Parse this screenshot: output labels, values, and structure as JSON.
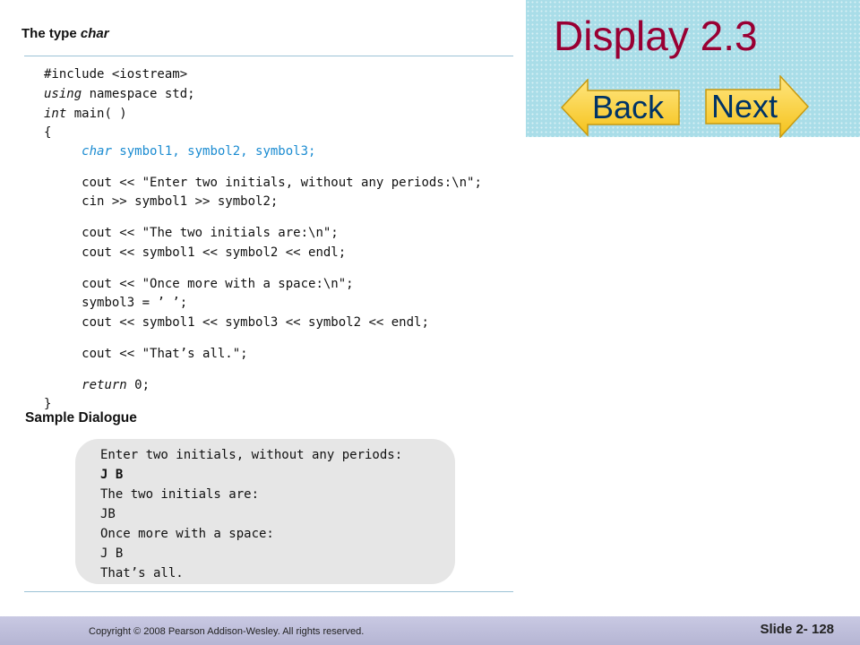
{
  "title": "Display 2.3",
  "nav": {
    "back_label": "Back",
    "next_label": "Next"
  },
  "headings": {
    "type_plain": "The type ",
    "type_em": "char",
    "sample": "Sample Dialogue"
  },
  "code": [
    {
      "pre": "",
      "kw": "",
      "text": "#include <iostream>"
    },
    {
      "pre": "",
      "kw": "using",
      "text": " namespace std;"
    },
    {
      "pre": "",
      "kw": "int",
      "text": " main( )"
    },
    {
      "pre": "",
      "kw": "",
      "text": "{"
    },
    {
      "pre": "     ",
      "kw": "char",
      "text": " symbol1, symbol2, symbol3;"
    },
    {
      "pre": "     ",
      "kw": "",
      "text": "cout << \"Enter two initials, without any periods:\\n\";"
    },
    {
      "pre": "     ",
      "kw": "",
      "text": "cin >> symbol1 >> symbol2;"
    },
    {
      "pre": "     ",
      "kw": "",
      "text": "cout << \"The two initials are:\\n\";"
    },
    {
      "pre": "     ",
      "kw": "",
      "text": "cout << symbol1 << symbol2 << endl;"
    },
    {
      "pre": "     ",
      "kw": "",
      "text": "cout << \"Once more with a space:\\n\";"
    },
    {
      "pre": "     ",
      "kw": "",
      "text": "symbol3 = ’ ’;"
    },
    {
      "pre": "     ",
      "kw": "",
      "text": "cout << symbol1 << symbol3 << symbol2 << endl;"
    },
    {
      "pre": "     ",
      "kw": "",
      "text": "cout << \"That’s all.\";"
    },
    {
      "pre": "     ",
      "kw": "return",
      "text": " 0;"
    },
    {
      "pre": "",
      "kw": "",
      "text": "}"
    }
  ],
  "dialogue": [
    "Enter two initials, without any periods:",
    "J B",
    "The two initials are:",
    "JB",
    "Once more with a space:",
    "J B",
    "That’s all."
  ],
  "footer": {
    "copyright": "Copyright © 2008 Pearson Addison-Wesley.  All rights reserved.",
    "slide_number": "Slide 2- 128"
  },
  "colors": {
    "title": "#990033",
    "nav_button": "#ffd84a",
    "nav_text": "#003366",
    "panel": "#a9dde8",
    "code_highlight": "#1a8bd1"
  }
}
